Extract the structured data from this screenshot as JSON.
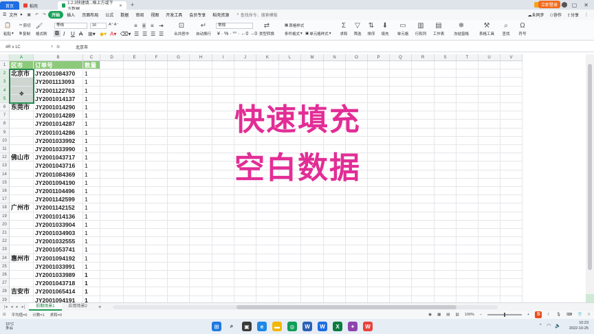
{
  "titlebar": {
    "tabs": [
      {
        "label": "首页",
        "kind": "home"
      },
      {
        "label": "稻壳",
        "kind": "shell"
      },
      {
        "label": "1.2.3快速填...格上方或下方数据",
        "kind": "doc"
      }
    ],
    "add": "+",
    "right_icons": [
      "▭",
      "─",
      "▢",
      "✕"
    ]
  },
  "menubar": {
    "file_label": "文件",
    "items": [
      "开始",
      "插入",
      "页面布局",
      "公式",
      "数据",
      "审阅",
      "视图",
      "开发工具",
      "会员专享",
      "稻壳资源"
    ],
    "active": "开始",
    "search_text": "查找命令、搜索模板",
    "sync_label": "未同步",
    "collab_label": "协作",
    "share_label": "分享",
    "login_label": "立即登录"
  },
  "ribbon": {
    "paste": "粘贴",
    "cut": "剪切",
    "copy": "复制",
    "format_painter": "格式刷",
    "font": "等线",
    "size": "16",
    "number_format": "常规",
    "merge": "合并居中",
    "wrap": "自动换行",
    "convert": "类型转换",
    "table_style": "表格样式",
    "cond_format": "条件格式",
    "cell_style": "单元格样式",
    "sum": "求和",
    "filter": "筛选",
    "sort": "排序",
    "fill": "填充",
    "cell": "单元格",
    "rowcol": "行和列",
    "worksheet": "工作表",
    "freeze": "冻结窗格",
    "table_tools": "表格工具",
    "find": "查找",
    "symbol": "符号"
  },
  "formula": {
    "namebox": "4R x 1C",
    "content": "北京市"
  },
  "columns": [
    "A",
    "B",
    "C",
    "D",
    "E",
    "F",
    "G",
    "H",
    "I",
    "J",
    "K",
    "L",
    "M",
    "N",
    "O",
    "P",
    "Q",
    "R",
    "S",
    "T",
    "U",
    "V"
  ],
  "table": {
    "headers": [
      "区市",
      "订单号",
      "数量"
    ],
    "rows": [
      [
        "北京市",
        "JY2001084370",
        "1"
      ],
      [
        "",
        "JY2001113093",
        "1"
      ],
      [
        "",
        "JY2001122763",
        "1"
      ],
      [
        "",
        "JY2001014137",
        "1"
      ],
      [
        "东莞市",
        "JY2001014290",
        "1"
      ],
      [
        "",
        "JY2001014289",
        "1"
      ],
      [
        "",
        "JY2001014287",
        "1"
      ],
      [
        "",
        "JY2001014286",
        "1"
      ],
      [
        "",
        "JY2001033992",
        "1"
      ],
      [
        "",
        "JY2001033990",
        "1"
      ],
      [
        "佛山市",
        "JY2001043717",
        "1"
      ],
      [
        "",
        "JY2001043716",
        "1"
      ],
      [
        "",
        "JY2001084369",
        "1"
      ],
      [
        "",
        "JY2001094190",
        "1"
      ],
      [
        "",
        "JY2001104496",
        "1"
      ],
      [
        "",
        "JY2001142599",
        "1"
      ],
      [
        "广州市",
        "JY2001142152",
        "1"
      ],
      [
        "",
        "JY2001014136",
        "1"
      ],
      [
        "",
        "JY2001033904",
        "1"
      ],
      [
        "",
        "JY2001034903",
        "1"
      ],
      [
        "",
        "JY2001032555",
        "1"
      ],
      [
        "",
        "JY2001053741",
        "1"
      ],
      [
        "惠州市",
        "JY2001094192",
        "1"
      ],
      [
        "",
        "JY2001033991",
        "1"
      ],
      [
        "",
        "JY2001033989",
        "1"
      ],
      [
        "",
        "JY2001043718",
        "1"
      ],
      [
        "吉安市",
        "JY2001065414",
        "1"
      ],
      [
        "",
        "JY2001094191",
        "1"
      ]
    ]
  },
  "overlay": {
    "line1": "快速填充",
    "line2": "空白数据"
  },
  "sheets": {
    "tabs": [
      "前期场景1",
      "应用场景2"
    ],
    "active": "前期场景1",
    "add": "+"
  },
  "status": {
    "average": "平均值=0",
    "count": "计数=1",
    "sum": "求和=0",
    "zoom": "100%",
    "logo": "S"
  },
  "taskbar": {
    "temp": "15°C",
    "weather": "多云",
    "time": "10:23",
    "date": "2022-10-25"
  },
  "colors": {
    "accent_green": "#1aa35a",
    "header_green": "#8cc97a",
    "overlay_pink": "#e22d96",
    "home_blue": "#1e6de3"
  }
}
